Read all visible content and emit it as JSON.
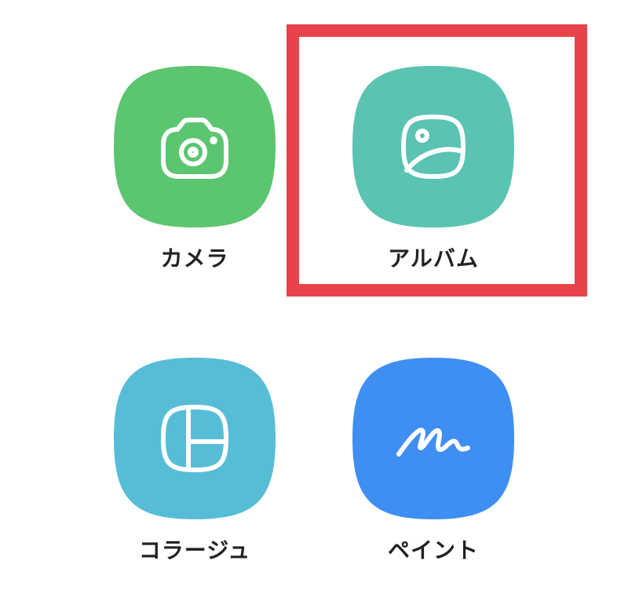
{
  "apps": [
    {
      "id": "camera",
      "label": "カメラ",
      "color": "#5cc56f",
      "icon": "camera-icon"
    },
    {
      "id": "album",
      "label": "アルバム",
      "color": "#5ac3b1",
      "icon": "image-icon"
    },
    {
      "id": "collage",
      "label": "コラージュ",
      "color": "#57bdd6",
      "icon": "collage-grid-icon"
    },
    {
      "id": "paint",
      "label": "ペイント",
      "color": "#3f8ef2",
      "icon": "scribble-icon"
    }
  ],
  "highlight": {
    "color": "#e8434a",
    "target": "album"
  }
}
